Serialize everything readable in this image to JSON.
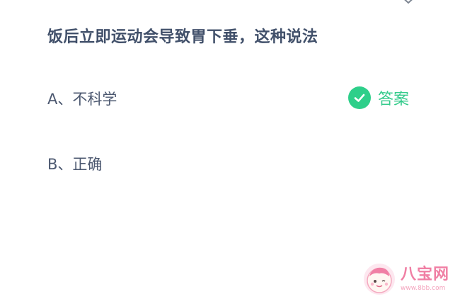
{
  "question": {
    "text": "饭后立即运动会导致胃下垂，这种说法"
  },
  "options": [
    {
      "label": "A、不科学"
    },
    {
      "label": "B、正确"
    }
  ],
  "answer": {
    "label": "答案",
    "icon": "check-circle-icon",
    "color": "#2ecf8a"
  },
  "close": {
    "icon": "close-icon"
  },
  "watermark": {
    "name": "八宝网",
    "url": "www.8bb.com"
  }
}
